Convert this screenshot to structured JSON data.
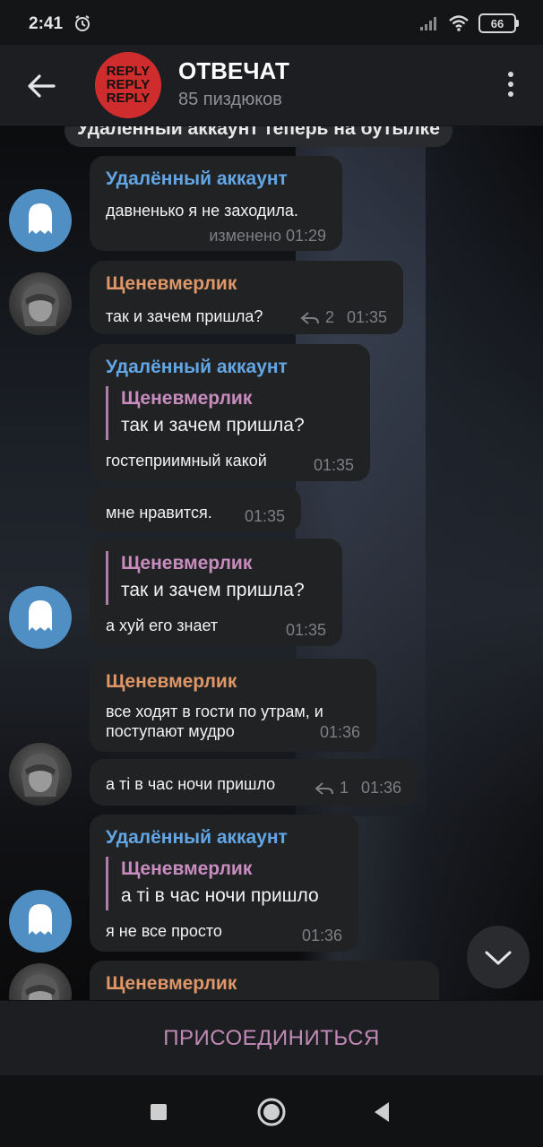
{
  "status_bar": {
    "time": "2:41",
    "battery": "66"
  },
  "header": {
    "title": "ОТВЕЧАТ",
    "subtitle": "85 пиздюков",
    "avatar_text": [
      "REPLY",
      "REPLY",
      "REPLY"
    ]
  },
  "service_message": "Удаленный аккаунт теперь на бутылке",
  "messages": [
    {
      "sender": "Удалённый аккаунт",
      "text": "давненько я не заходила.",
      "meta": "изменено 01:29"
    },
    {
      "sender": "Щеневмерлик",
      "text": "так и зачем пришла?",
      "replies": "2",
      "time": "01:35"
    },
    {
      "sender": "Удалённый аккаунт",
      "quote_name": "Щеневмерлик",
      "quote_text": "так и зачем пришла?",
      "text": "гостеприимный какой",
      "time": "01:35"
    },
    {
      "text": "мне нравится.",
      "time": "01:35"
    },
    {
      "quote_name": "Щеневмерлик",
      "quote_text": "так и зачем пришла?",
      "text": "а хуй его знает",
      "time": "01:35"
    },
    {
      "sender": "Щеневмерлик",
      "text_line1": "все ходят в гости по утрам, и",
      "text_line2": "поступают мудро",
      "time": "01:36"
    },
    {
      "text": "а ті в час ночи пришло",
      "replies": "1",
      "time": "01:36"
    },
    {
      "sender": "Удалённый аккаунт",
      "quote_name": "Щеневмерлик",
      "quote_text": "а ті в час ночи пришло",
      "text": "я не все просто",
      "time": "01:36"
    },
    {
      "sender": "Щеневмерлик"
    }
  ],
  "join_button": "ПРИСОЕДИНИТЬСЯ",
  "colors": {
    "sender_blue": "#62a6e6",
    "sender_orange": "#e09767",
    "quote_accent": "#c98cbf",
    "bubble": "#212224"
  }
}
